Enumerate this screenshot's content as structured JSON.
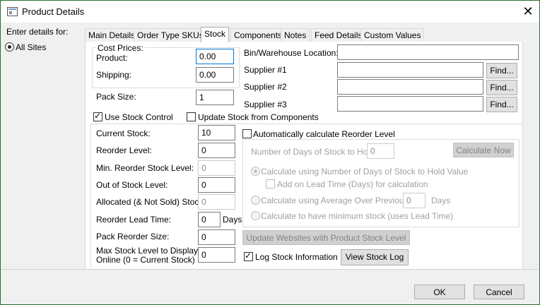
{
  "window": {
    "title": "Product Details"
  },
  "sidebar": {
    "enter_label": "Enter details for:",
    "all_sites": "All Sites"
  },
  "tabs": [
    {
      "label": "Main Details"
    },
    {
      "label": "Order Type SKUs"
    },
    {
      "label": "Stock"
    },
    {
      "label": "Components"
    },
    {
      "label": "Notes"
    },
    {
      "label": "Feed Details"
    },
    {
      "label": "Custom Values"
    }
  ],
  "cost": {
    "group_label": "Cost Prices:",
    "product_label": "Product:",
    "product_value": "0.00",
    "shipping_label": "Shipping:",
    "shipping_value": "0.00"
  },
  "pack_size": {
    "label": "Pack Size:",
    "value": "1"
  },
  "location": {
    "bin_label": "Bin/Warehouse Location:",
    "bin_value": "",
    "supplier1_label": "Supplier #1",
    "supplier1_value": "",
    "supplier2_label": "Supplier #2",
    "supplier2_value": "",
    "supplier3_label": "Supplier #3",
    "supplier3_value": "",
    "find_label": "Find..."
  },
  "stock_control": {
    "use_label": "Use Stock Control",
    "update_from_components_label": "Update Stock from Components",
    "current_stock_label": "Current Stock:",
    "current_stock_value": "10",
    "reorder_level_label": "Reorder Level:",
    "reorder_level_value": "0",
    "min_reorder_label": "Min. Reorder Stock Level:",
    "min_reorder_value": "0",
    "out_of_stock_label": "Out of Stock Level:",
    "out_of_stock_value": "0",
    "allocated_label": "Allocated (& Not Sold) Stock:",
    "allocated_value": "0",
    "lead_time_label": "Reorder Lead Time:",
    "lead_time_value": "0",
    "lead_time_unit": "Days",
    "pack_reorder_label": "Pack Reorder Size:",
    "pack_reorder_value": "0",
    "max_stock_label_line1": "Max Stock Level to Display",
    "max_stock_label_line2": "Online (0 = Current Stock)",
    "max_stock_value": "0"
  },
  "reorder_calc": {
    "auto_label": "Automatically calculate Reorder Level",
    "days_hold_label": "Number of Days of Stock to Hold:",
    "days_hold_value": "0",
    "calc_now_label": "Calculate Now",
    "opt_days_label": "Calculate using Number of Days of Stock to Hold Value",
    "add_lead_label": "Add on Lead Time (Days) for calculation",
    "opt_avg_label": "Calculate using Average Over Previous",
    "avg_value": "0",
    "avg_unit": "Days",
    "opt_min_label": "Calculate to have minimum stock (uses Lead Time)"
  },
  "actions": {
    "update_websites_label": "Update Websites with Product Stock Level",
    "log_stock_label": "Log Stock Information",
    "view_log_label": "View Stock Log",
    "ok_label": "OK",
    "cancel_label": "Cancel"
  }
}
